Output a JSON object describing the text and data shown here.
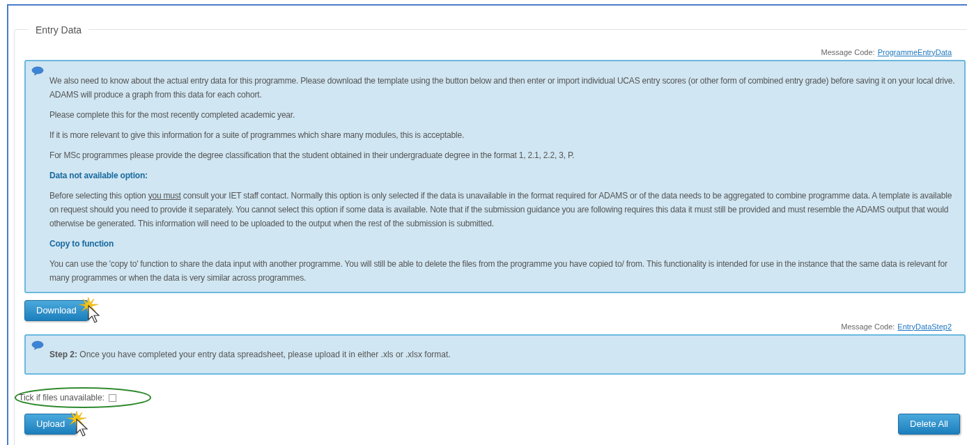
{
  "fieldset": {
    "legend": "Entry Data"
  },
  "message_1": {
    "code_label": "Message Code:",
    "code_link": "ProgrammeEntryData",
    "blocks": [
      {
        "kind": "paragraph",
        "segments": [
          {
            "text": "We also need to know about the actual entry data for this programme. Please download the template using the button below and then enter or import individual UCAS entry scores (or other form of combined entry grade) before saving it on your local drive.  ADAMS will produce a graph from this data for each cohort.",
            "underline": false
          }
        ]
      },
      {
        "kind": "paragraph",
        "segments": [
          {
            "text": "Please complete this for the most recently completed academic year.",
            "underline": false
          }
        ]
      },
      {
        "kind": "paragraph",
        "segments": [
          {
            "text": "If it is more relevant to give this information for a suite of programmes which share many modules, this is acceptable.",
            "underline": false
          }
        ]
      },
      {
        "kind": "paragraph",
        "segments": [
          {
            "text": "For MSc programmes please provide the degree classification that the student obtained in their undergraduate degree in the format 1, 2.1, 2.2, 3, P.",
            "underline": false
          }
        ]
      },
      {
        "kind": "heading",
        "text": "Data not available option:"
      },
      {
        "kind": "paragraph",
        "segments": [
          {
            "text": "Before selecting this option ",
            "underline": false
          },
          {
            "text": "you must",
            "underline": true
          },
          {
            "text": " consult your IET staff contact.  Normally this option is only selected if the data is unavailable in the format required for ADAMS or of the data needs to be aggregated to combine programme data.  A template is available on request should you need to provide it separately.  You cannot select this option if some data is available.  Note that if the submission guidance you are following requires this data it must still be provided and must resemble the ADAMS output that would otherwise be generated.  This information will need to be uploaded to the output when the rest of the submission is submitted.",
            "underline": false
          }
        ]
      },
      {
        "kind": "heading",
        "text": "Copy to function"
      },
      {
        "kind": "paragraph",
        "segments": [
          {
            "text": "You can use the 'copy to' function to share the data input with another programme. You will still be able to delete the files from the programme you have copied to/ from. This functionality is intended for use in the instance that the same data is relevant for many programmes or when the data is very similar across programmes.",
            "underline": false
          }
        ]
      }
    ]
  },
  "download_button": "Download",
  "message_2": {
    "code_label": "Message Code:",
    "code_link": "EntryDataStep2",
    "text": "**Step 2:** Once you have completed your entry data spreadsheet, please upload it in either .xls or .xlsx format."
  },
  "unavailable_checkbox": {
    "label": "Tick if files unavailable:",
    "checked": false
  },
  "upload_button": "Upload",
  "delete_all_button": "Delete All"
}
